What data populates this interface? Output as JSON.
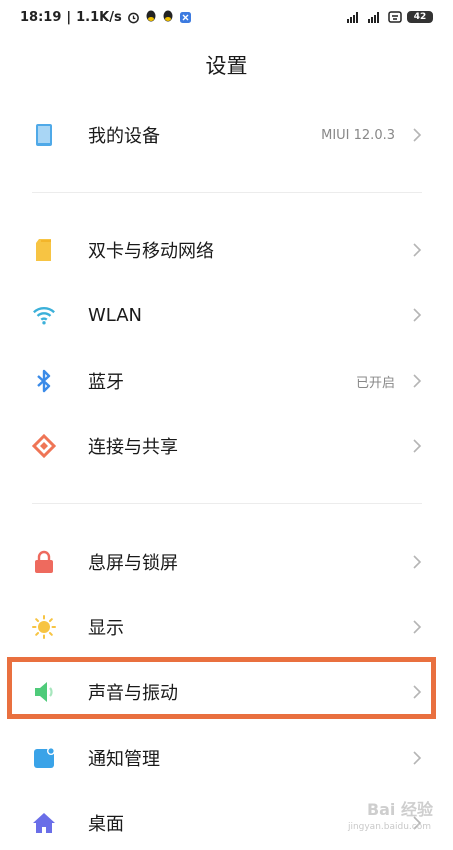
{
  "status_bar": {
    "time": "18:19",
    "speed": "1.1K/s",
    "battery": "42",
    "icons_left": [
      "alarm-icon",
      "qq-icon",
      "qq-icon",
      "app-icon"
    ],
    "icons_right": [
      "signal-icon",
      "signal-icon",
      "wifi-icon",
      "battery-icon"
    ]
  },
  "header": {
    "title": "设置"
  },
  "sections": [
    [
      {
        "id": "my-device",
        "label": "我的设备",
        "value": "MIUI 12.0.3",
        "icon": "device-icon",
        "color": "#4fa9e8"
      }
    ],
    [
      {
        "id": "sim",
        "label": "双卡与移动网络",
        "value": "",
        "icon": "sim-icon",
        "color": "#f7c443"
      },
      {
        "id": "wlan",
        "label": "WLAN",
        "value": "",
        "icon": "wifi-icon",
        "color": "#3bb0d9"
      },
      {
        "id": "bluetooth",
        "label": "蓝牙",
        "value": "已开启",
        "icon": "bluetooth-icon",
        "color": "#3b8be8"
      },
      {
        "id": "connection",
        "label": "连接与共享",
        "value": "",
        "icon": "share-icon",
        "color": "#ef7556"
      }
    ],
    [
      {
        "id": "lock",
        "label": "息屏与锁屏",
        "value": "",
        "icon": "lock-icon",
        "color": "#ee6a5e"
      },
      {
        "id": "display",
        "label": "显示",
        "value": "",
        "icon": "sun-icon",
        "color": "#f7c443"
      },
      {
        "id": "sound",
        "label": "声音与振动",
        "value": "",
        "icon": "speaker-icon",
        "color": "#4fcb7a"
      },
      {
        "id": "notifications",
        "label": "通知管理",
        "value": "",
        "icon": "notification-icon",
        "color": "#3aa3e8"
      },
      {
        "id": "desktop",
        "label": "桌面",
        "value": "",
        "icon": "home-icon",
        "color": "#6a6ee8"
      }
    ]
  ],
  "watermark": {
    "text": "Bai 经验",
    "sub": "jingyan.baidu.com"
  }
}
